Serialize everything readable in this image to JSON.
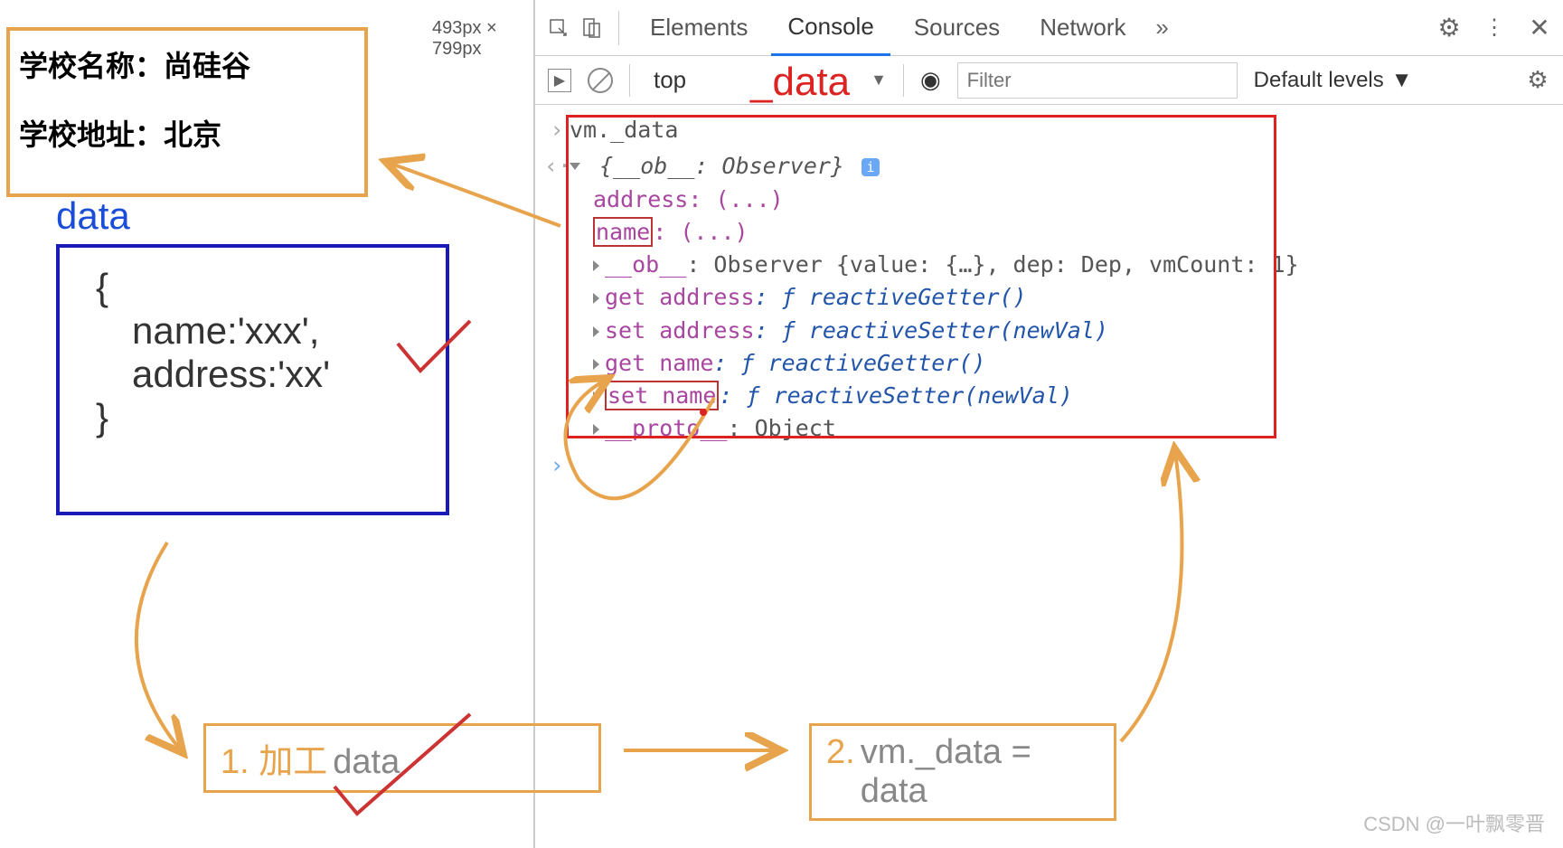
{
  "page": {
    "dimensions": "493px × 799px",
    "school_name": "学校名称：尚硅谷",
    "school_address": "学校地址：北京",
    "data_label": "data",
    "data_body": {
      "open": "{",
      "line1": "name:'xxx',",
      "line2": "address:'xx'",
      "close": "}"
    }
  },
  "devtools": {
    "tabs": {
      "elements": "Elements",
      "console": "Console",
      "sources": "Sources",
      "network": "Network"
    },
    "toolbar": {
      "context": "top",
      "filter_placeholder": "Filter",
      "levels": "Default levels"
    }
  },
  "console": {
    "input": "vm._data",
    "observer_header": "{__ob__: Observer}",
    "address_line": "address: (...)",
    "name_key": "name",
    "name_rest": ": (...)",
    "ob_line_key": "__ob__",
    "ob_line_val": ": Observer {value: {…}, dep: Dep, vmCount: 1}",
    "get_addr": "get address",
    "get_addr_val": ": ƒ reactiveGetter()",
    "set_addr": "set address",
    "set_addr_val": ": ƒ reactiveSetter(newVal)",
    "get_name": "get name",
    "get_name_val": ": ƒ reactiveGetter()",
    "set_name": "set name",
    "set_name_val": ": ƒ reactiveSetter(newVal)",
    "proto": "__proto__",
    "proto_val": ": Object"
  },
  "annotations": {
    "data_label": "_data",
    "step1_prefix": "1. 加工",
    "step1_word": " data",
    "step2_prefix": "2.",
    "step2_body": "vm._data = data"
  },
  "watermark": "CSDN @一叶飘零晋"
}
